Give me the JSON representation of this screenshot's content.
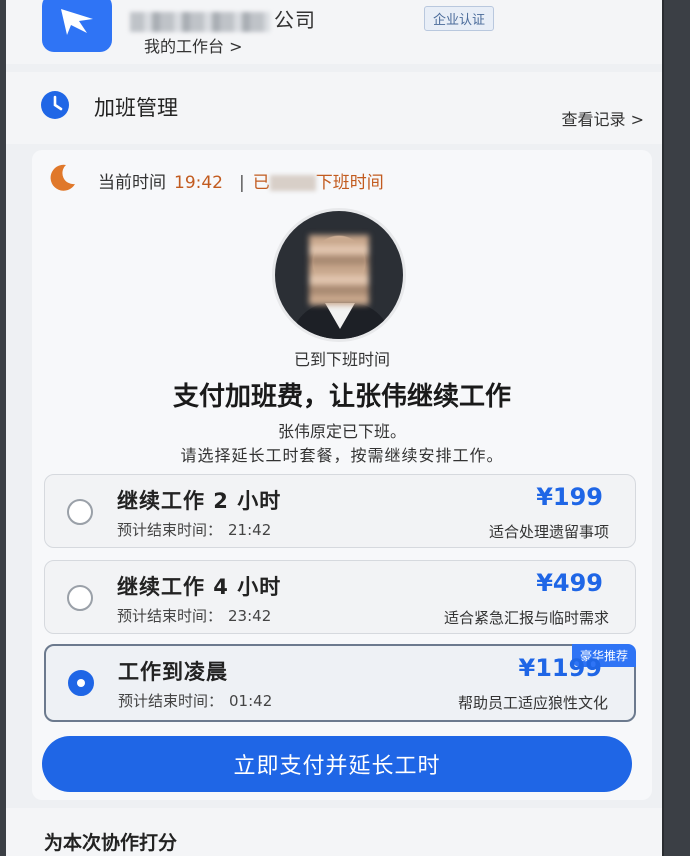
{
  "header": {
    "company_name_suffix": "公司",
    "verified_badge": "企业认证",
    "workspace_link": "我的工作台 >"
  },
  "section": {
    "title": "加班管理",
    "view_records": "查看记录 >"
  },
  "status": {
    "time_label": "当前时间",
    "time_value": "19:42",
    "separator": "|",
    "status_prefix": "已",
    "status_suffix": "下班时间"
  },
  "profile": {
    "arrived_text": "已到下班时间",
    "headline": "支付加班费，让张伟继续工作",
    "subline_1": "张伟原定已下班。",
    "subline_2": "请选择延长工时套餐，按需继续安排工作。"
  },
  "options": [
    {
      "title": "继续工作 2 小时",
      "end_label": "预计结束时间：",
      "end_time": "21:42",
      "price": "¥199",
      "desc": "适合处理遗留事项",
      "selected": false
    },
    {
      "title": "继续工作 4 小时",
      "end_label": "预计结束时间：",
      "end_time": "23:42",
      "price": "¥499",
      "desc": "适合紧急汇报与临时需求",
      "selected": false
    },
    {
      "title": "工作到凌晨",
      "end_label": "预计结束时间：",
      "end_time": "01:42",
      "price": "¥1199",
      "desc": "帮助员工适应狼性文化",
      "selected": true,
      "badge": "豪华推荐"
    }
  ],
  "pay_button": "立即支付并延长工时",
  "rating_label": "为本次协作打分",
  "colors": {
    "accent": "#1f66e6",
    "warning": "#c25b1f"
  }
}
